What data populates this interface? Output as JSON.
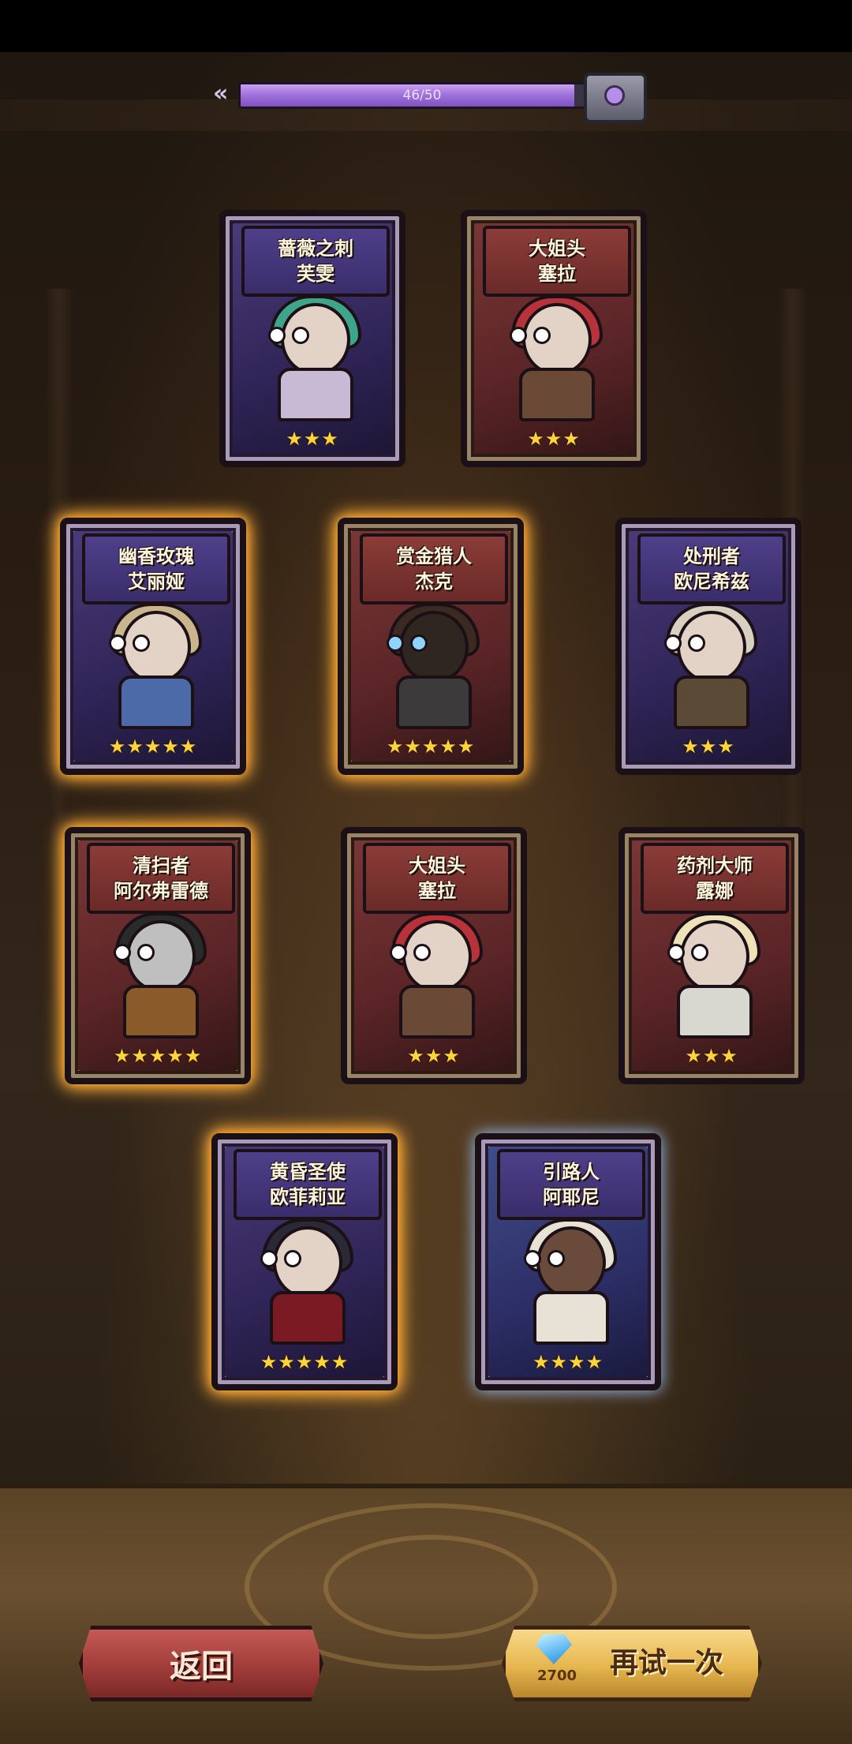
{
  "progress": {
    "text": "46/50",
    "value": 46,
    "max": 50
  },
  "cards": [
    {
      "title_line1": "蔷薇之刺",
      "title_line2": "芙雯",
      "stars": "★★★",
      "theme": "purple"
    },
    {
      "title_line1": "大姐头",
      "title_line2": "塞拉",
      "stars": "★★★",
      "theme": "red"
    },
    {
      "title_line1": "幽香玫瑰",
      "title_line2": "艾丽娅",
      "stars": "★★★★★",
      "theme": "purple"
    },
    {
      "title_line1": "赏金猎人",
      "title_line2": "杰克",
      "stars": "★★★★★",
      "theme": "red"
    },
    {
      "title_line1": "处刑者",
      "title_line2": "欧尼希兹",
      "stars": "★★★",
      "theme": "purple"
    },
    {
      "title_line1": "清扫者",
      "title_line2": "阿尔弗雷德",
      "stars": "★★★★★",
      "theme": "red"
    },
    {
      "title_line1": "大姐头",
      "title_line2": "塞拉",
      "stars": "★★★",
      "theme": "red"
    },
    {
      "title_line1": "药剂大师",
      "title_line2": "露娜",
      "stars": "★★★",
      "theme": "red"
    },
    {
      "title_line1": "黄昏圣使",
      "title_line2": "欧菲莉亚",
      "stars": "★★★★★",
      "theme": "purple"
    },
    {
      "title_line1": "引路人",
      "title_line2": "阿耶尼",
      "stars": "★★★★",
      "theme": "purple"
    }
  ],
  "buttons": {
    "back_label": "返回",
    "retry_label": "再试一次",
    "diamond_cost": "2700"
  },
  "colors": {
    "glow_gold": "#ff9d22",
    "glow_blue": "#9ec4ff",
    "progress_fill": "#9d6fd9"
  }
}
